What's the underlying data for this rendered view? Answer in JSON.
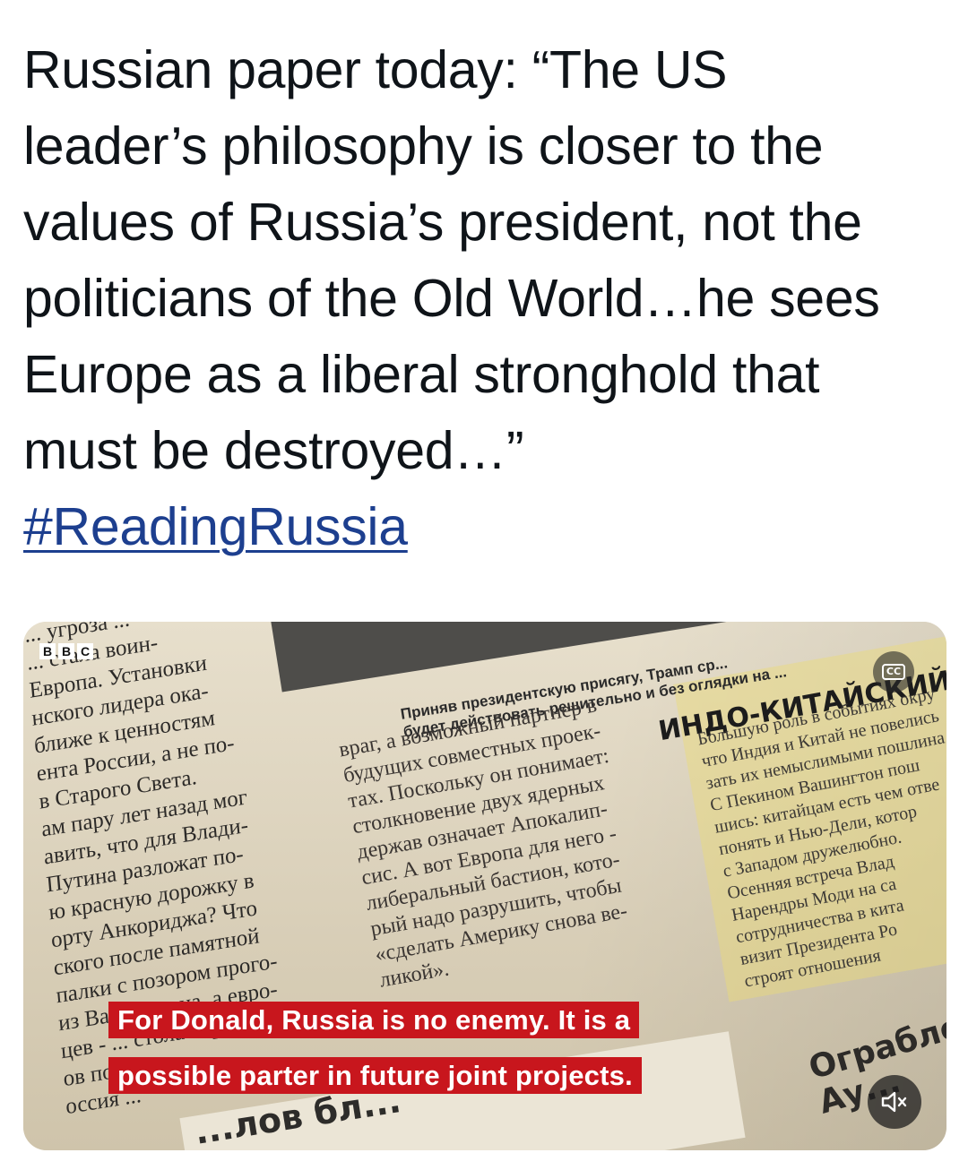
{
  "post": {
    "lines": [
      "Russian paper today: “The US",
      "leader’s philosophy is closer to the",
      "values of Russia’s president, not the",
      "politicians of the Old World…he sees",
      "Europe as a liberal stronghold that",
      "must be destroyed…”"
    ],
    "hashtag": "#ReadingRussia"
  },
  "video": {
    "logo_letters": [
      "B",
      "B",
      "C"
    ],
    "headline": [
      "Приняв президентскую присягу, Трамп ср...",
      "будет действовать решительно и без оглядки на ..."
    ],
    "section_title": "ИНДО-КИТАЙСКИЙ ОТВ",
    "left_column": [
      "... угроза ...",
      "... стала воин-",
      "Европа. Установки",
      "нского лидера ока-",
      "ближе к ценностям",
      "ента России, а не по-",
      "в Старого Света.",
      "ам пару лет назад мог",
      "авить, что для Влади-",
      "Путина разложат по-",
      "ю красную дорожку в",
      "орту Анкориджа? Что",
      "ского после памятной",
      "палки с позором прого-",
      "из Вашингтона, а евро-",
      "цев - ... стола перего-",
      "ов по ...",
      "оссия ..."
    ],
    "middle_column": [
      "враг, а возможный партнер в",
      "будущих совместных проек-",
      "тах. Поскольку он понимает:",
      "столкновение двух ядерных",
      "держав означает Апокалип-",
      "сис. А вот Европа для него -",
      "либеральный бастион, кото-",
      "рый надо разрушить, чтобы",
      "«сделать Америку снова ве-",
      "ликой»."
    ],
    "right_column": [
      "Большую роль в событиях окру",
      "что Индия и Китай не повелись",
      "зать их немыслимыми пошлина",
      "С Пекином Вашингтон пош",
      "шись: китайцам есть чем отве",
      "понять и Нью-Дели, котор",
      "с Западом дружелюбно.",
      "Осенняя встреча Влад",
      "Нарендры Моди на са",
      "сотрудничества в кита",
      "визит Президента Ро",
      "строят отношения"
    ],
    "bottom_word": "...лов бл...",
    "corner_word": [
      "Ограбле",
      "Ау..."
    ],
    "cc_label": "CC",
    "subtitle_lines": [
      "For Donald, Russia is no enemy. It is a",
      "possible parter in future joint projects."
    ],
    "icons": {
      "cc": "closed-captions-icon",
      "mute": "speaker-muted-icon"
    },
    "colors": {
      "subtitle_bg": "#c8161d",
      "hashtag": "#1d3f8f"
    }
  }
}
